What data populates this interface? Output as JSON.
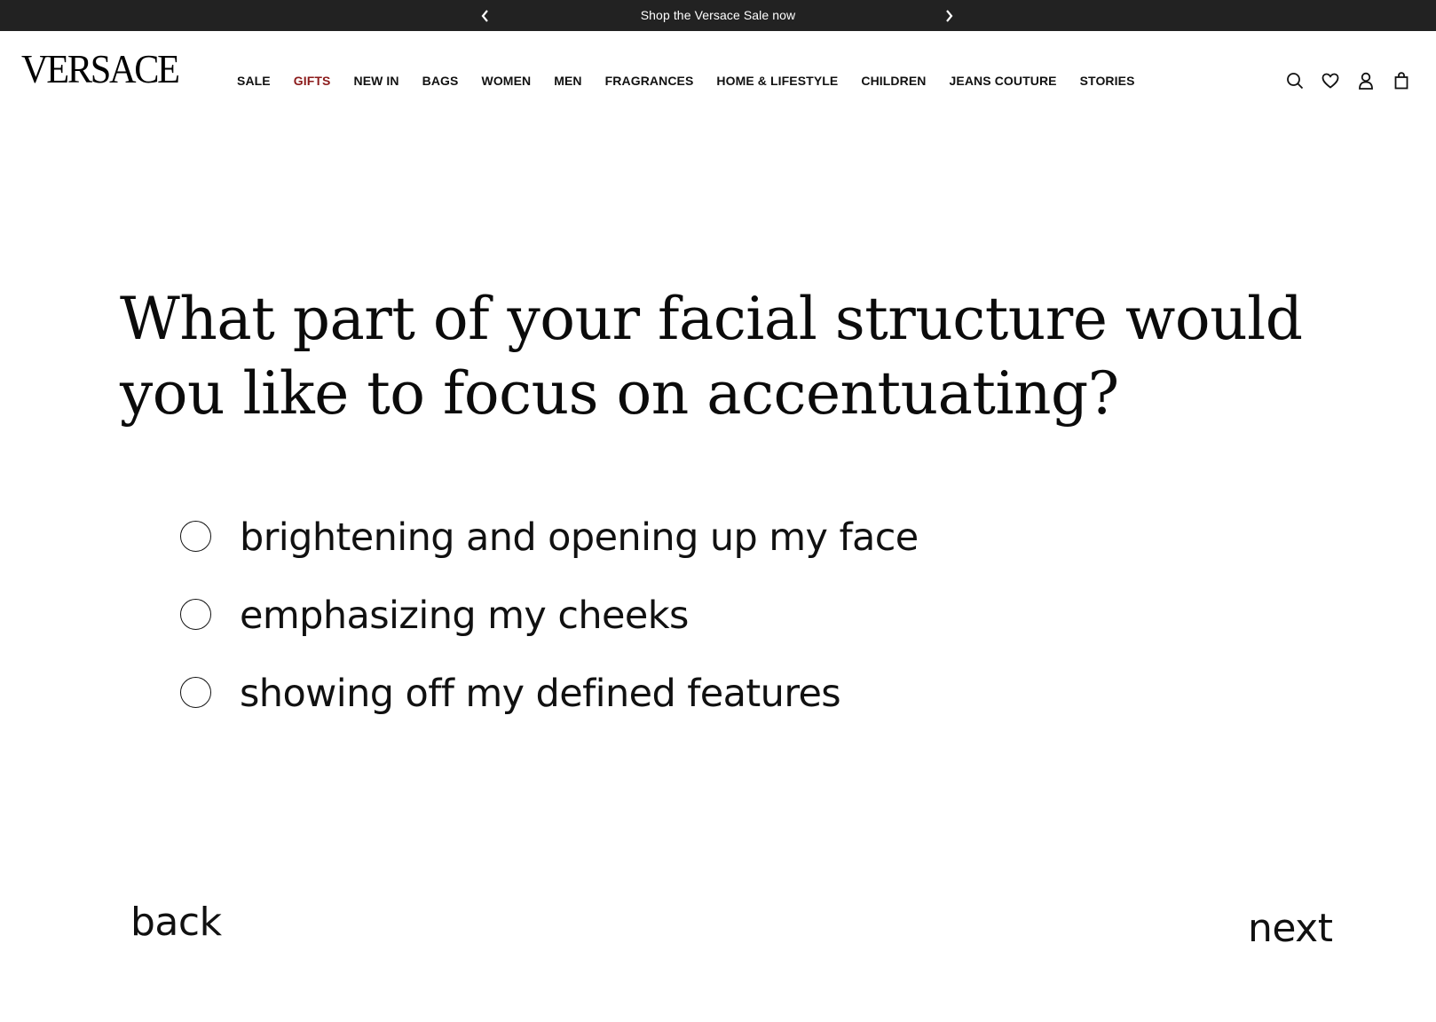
{
  "promo": {
    "text": "Shop the Versace Sale now",
    "prev_icon": "chevron-left-icon",
    "next_icon": "chevron-right-icon",
    "background": "#222222"
  },
  "header": {
    "logo": "VERSACE",
    "nav": [
      {
        "label": "SALE"
      },
      {
        "label": "GIFTS",
        "accent": "#8b1a1a"
      },
      {
        "label": "NEW IN"
      },
      {
        "label": "BAGS"
      },
      {
        "label": "WOMEN"
      },
      {
        "label": "MEN"
      },
      {
        "label": "FRAGRANCES"
      },
      {
        "label": "HOME & LIFESTYLE"
      },
      {
        "label": "CHILDREN"
      },
      {
        "label": "JEANS COUTURE"
      },
      {
        "label": "STORIES"
      }
    ],
    "icons": [
      "search-icon",
      "heart-icon",
      "user-icon",
      "shopping-bag-icon"
    ]
  },
  "quiz": {
    "question": "What part of your facial structure would you like to focus on accentuating?",
    "options": [
      {
        "label": "brightening and opening up my face",
        "selected": false
      },
      {
        "label": "emphasizing my cheeks",
        "selected": false
      },
      {
        "label": "showing off my defined features",
        "selected": false
      }
    ],
    "back_label": "back",
    "next_label": "next"
  }
}
